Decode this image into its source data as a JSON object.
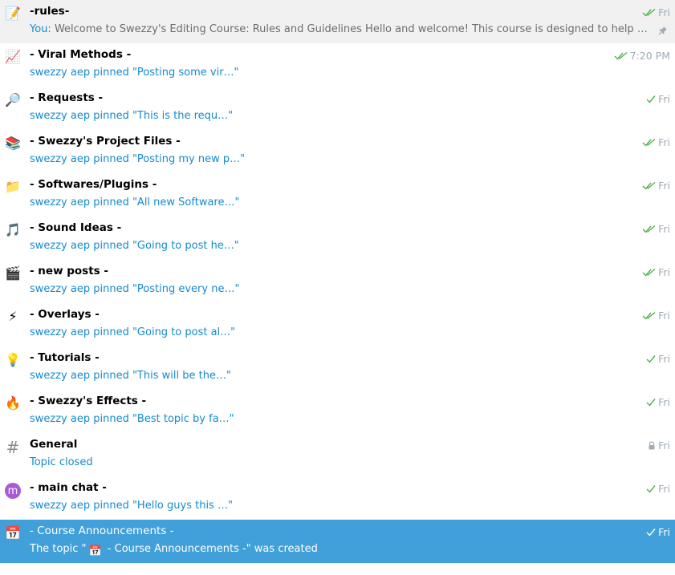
{
  "chats": [
    {
      "id": "rules",
      "icon": "memo-icon",
      "glyph": "📝",
      "title": "-rules-",
      "sender": "You:",
      "message": "Welcome to Swezzy's Editing Course: Rules and Guidelines  Hello and welcome! This course is designed to help you master e…",
      "time": "Fri",
      "status": "double",
      "pinned": true,
      "state": "hover"
    },
    {
      "id": "viral",
      "icon": "chart-up-icon",
      "glyph": "📈",
      "title": "- Viral Methods -",
      "message": "swezzy aep pinned \"Posting some vir…\"",
      "time": "7:20 PM",
      "status": "double"
    },
    {
      "id": "requests",
      "icon": "magnifier-icon",
      "glyph": "🔎",
      "title": "- Requests -",
      "message": "swezzy aep pinned \"This is the requ…\"",
      "time": "Fri",
      "status": "single"
    },
    {
      "id": "project",
      "icon": "books-icon",
      "glyph": "📚",
      "title": "- Swezzy's Project Files -",
      "message": "swezzy aep pinned \"Posting my new p…\"",
      "time": "Fri",
      "status": "double"
    },
    {
      "id": "software",
      "icon": "folder-icon",
      "glyph": "📁",
      "title": "- Softwares/Plugins -",
      "message": "swezzy aep pinned \"All new Software…\"",
      "time": "Fri",
      "status": "double"
    },
    {
      "id": "sound",
      "icon": "music-note-icon",
      "glyph": "🎵",
      "title": "- Sound Ideas -",
      "message": "swezzy aep pinned \"Going to post he…\"",
      "time": "Fri",
      "status": "double"
    },
    {
      "id": "newposts",
      "icon": "clapper-icon",
      "glyph": "🎬",
      "title": "- new posts -",
      "message": "swezzy aep pinned \"Posting every ne…\"",
      "time": "Fri",
      "status": "double"
    },
    {
      "id": "overlays",
      "icon": "lightning-icon",
      "glyph": "⚡",
      "title": "- Overlays -",
      "message": "swezzy aep pinned \"Going to post al…\"",
      "time": "Fri",
      "status": "double"
    },
    {
      "id": "tutorials",
      "icon": "lightbulb-icon",
      "glyph": "💡",
      "title": "- Tutorials -",
      "message": "swezzy aep pinned \"This will be the…\"",
      "time": "Fri",
      "status": "single"
    },
    {
      "id": "effects",
      "icon": "fire-icon",
      "glyph": "🔥",
      "title": "- Swezzy's Effects -",
      "message": "swezzy aep pinned \"Best topic by fa…\"",
      "time": "Fri",
      "status": "single"
    },
    {
      "id": "general",
      "icon": "hash-icon",
      "glyph": "#",
      "title": "General",
      "message": "Topic closed",
      "time": "Fri",
      "status": "lock"
    },
    {
      "id": "mainchat",
      "icon": "avatar-m-icon",
      "glyph": "m",
      "title": "- main chat -",
      "message": "swezzy aep pinned \"Hello guys this …\"",
      "time": "Fri",
      "status": "single"
    },
    {
      "id": "announcements",
      "icon": "calendar-icon",
      "glyph": "📅",
      "title": "- Course Announcements -",
      "message_prefix": "The topic \"",
      "message_suffix": " - Course Announcements -\" was created",
      "time": "Fri",
      "status": "single",
      "state": "selected"
    }
  ],
  "colors": {
    "accent": "#419fd9",
    "link": "#168acd",
    "check": "#4fae4e",
    "muted": "#a0acb6"
  }
}
